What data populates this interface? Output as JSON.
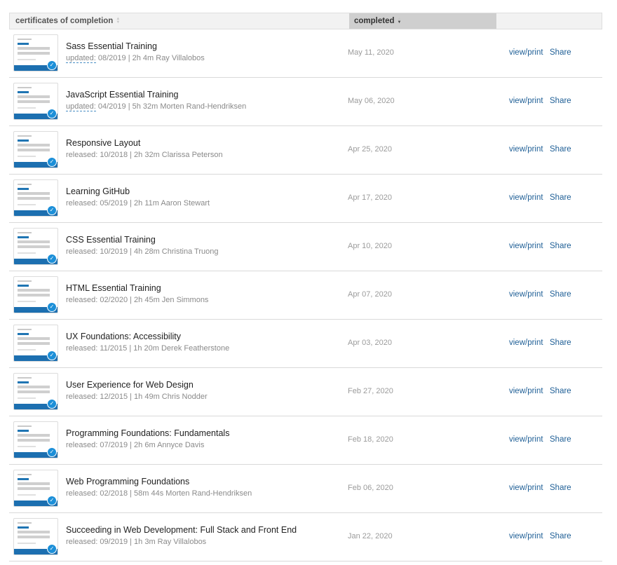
{
  "header": {
    "certificates_label": "certificates of completion",
    "completed_label": "completed"
  },
  "actions": {
    "view_label": "view/print",
    "share_label": "Share"
  },
  "rows": [
    {
      "title": "Sass Essential Training",
      "date_label": "updated:",
      "meta": " 08/2019 | 2h 4m Ray Villalobos",
      "completed": "May 11, 2020"
    },
    {
      "title": "JavaScript Essential Training",
      "date_label": "updated:",
      "meta": " 04/2019 | 5h 32m Morten Rand-Hendriksen",
      "completed": "May 06, 2020"
    },
    {
      "title": "Responsive Layout",
      "date_label": "released:",
      "meta": " 10/2018 | 2h 32m Clarissa Peterson",
      "completed": "Apr 25, 2020"
    },
    {
      "title": "Learning GitHub",
      "date_label": "released:",
      "meta": " 05/2019 | 2h 11m Aaron Stewart",
      "completed": "Apr 17, 2020"
    },
    {
      "title": "CSS Essential Training",
      "date_label": "released:",
      "meta": " 10/2019 | 4h 28m Christina Truong",
      "completed": "Apr 10, 2020"
    },
    {
      "title": "HTML Essential Training",
      "date_label": "released:",
      "meta": " 02/2020 | 2h 45m Jen Simmons",
      "completed": "Apr 07, 2020"
    },
    {
      "title": "UX Foundations: Accessibility",
      "date_label": "released:",
      "meta": " 11/2015 | 1h 20m Derek Featherstone",
      "completed": "Apr 03, 2020"
    },
    {
      "title": "User Experience for Web Design",
      "date_label": "released:",
      "meta": " 12/2015 | 1h 49m Chris Nodder",
      "completed": "Feb 27, 2020"
    },
    {
      "title": "Programming Foundations: Fundamentals",
      "date_label": "released:",
      "meta": " 07/2019 | 2h 6m Annyce Davis",
      "completed": "Feb 18, 2020"
    },
    {
      "title": "Web Programming Foundations",
      "date_label": "released:",
      "meta": " 02/2018 | 58m 44s Morten Rand-Hendriksen",
      "completed": "Feb 06, 2020"
    },
    {
      "title": "Succeeding in Web Development: Full Stack and Front End",
      "date_label": "released:",
      "meta": " 09/2019 | 1h 3m Ray Villalobos",
      "completed": "Jan 22, 2020"
    }
  ]
}
